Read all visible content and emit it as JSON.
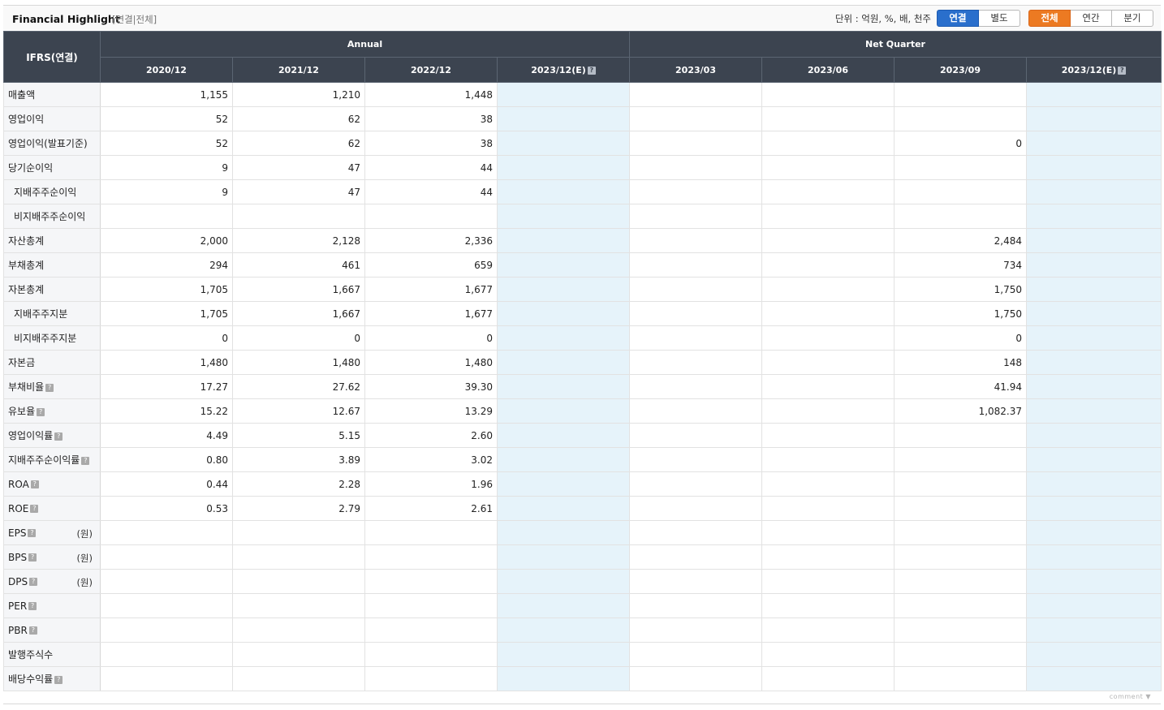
{
  "header": {
    "title": "Financial Highlight",
    "subtitle": "[연결|전체]",
    "unit_text": "단위 : 억원, %, 배, 천주",
    "consolidation_buttons": [
      "연결",
      "별도"
    ],
    "period_buttons": [
      "전체",
      "연간",
      "분기"
    ],
    "colors": {
      "consolidation_active": "#2a6fcc",
      "period_active": "#ec7a22",
      "header_bg": "#3c4450",
      "estimate_bg": "#e6f3fa"
    }
  },
  "table": {
    "corner_label": "IFRS(연결)",
    "group_annual": "Annual",
    "group_quarter": "Net Quarter",
    "columns": [
      "2020/12",
      "2021/12",
      "2022/12",
      "2023/12(E)",
      "2023/03",
      "2023/06",
      "2023/09",
      "2023/12(E)"
    ],
    "help_icon": "?",
    "rows": [
      {
        "label": "매출액",
        "suffix": "",
        "values": [
          "1,155",
          "1,210",
          "1,448",
          "",
          "",
          "",
          "",
          ""
        ]
      },
      {
        "label": "영업이익",
        "suffix": "",
        "values": [
          "52",
          "62",
          "38",
          "",
          "",
          "",
          "",
          ""
        ]
      },
      {
        "label": "영업이익(발표기준)",
        "suffix": "",
        "values": [
          "52",
          "62",
          "38",
          "",
          "",
          "",
          "0",
          ""
        ]
      },
      {
        "label": "당기순이익",
        "suffix": "",
        "values": [
          "9",
          "47",
          "44",
          "",
          "",
          "",
          "",
          ""
        ]
      },
      {
        "label": "지배주주순이익",
        "suffix": "",
        "values": [
          "9",
          "47",
          "44",
          "",
          "",
          "",
          "",
          ""
        ]
      },
      {
        "label": "비지배주주순이익",
        "suffix": "",
        "values": [
          "",
          "",
          "",
          "",
          "",
          "",
          "",
          ""
        ]
      },
      {
        "label": "자산총계",
        "suffix": "",
        "values": [
          "2,000",
          "2,128",
          "2,336",
          "",
          "",
          "",
          "2,484",
          ""
        ]
      },
      {
        "label": "부채총계",
        "suffix": "",
        "values": [
          "294",
          "461",
          "659",
          "",
          "",
          "",
          "734",
          ""
        ]
      },
      {
        "label": "자본총계",
        "suffix": "",
        "values": [
          "1,705",
          "1,667",
          "1,677",
          "",
          "",
          "",
          "1,750",
          ""
        ]
      },
      {
        "label": "지배주주지분",
        "suffix": "",
        "values": [
          "1,705",
          "1,667",
          "1,677",
          "",
          "",
          "",
          "1,750",
          ""
        ]
      },
      {
        "label": "비지배주주지분",
        "suffix": "",
        "values": [
          "0",
          "0",
          "0",
          "",
          "",
          "",
          "0",
          ""
        ]
      },
      {
        "label": "자본금",
        "suffix": "",
        "values": [
          "1,480",
          "1,480",
          "1,480",
          "",
          "",
          "",
          "148",
          ""
        ]
      },
      {
        "label": "부채비율",
        "suffix": "",
        "values": [
          "17.27",
          "27.62",
          "39.30",
          "",
          "",
          "",
          "41.94",
          ""
        ]
      },
      {
        "label": "유보율",
        "suffix": "",
        "values": [
          "15.22",
          "12.67",
          "13.29",
          "",
          "",
          "",
          "1,082.37",
          ""
        ]
      },
      {
        "label": "영업이익률",
        "suffix": "",
        "values": [
          "4.49",
          "5.15",
          "2.60",
          "",
          "",
          "",
          "",
          ""
        ]
      },
      {
        "label": "지배주주순이익률",
        "suffix": "",
        "values": [
          "0.80",
          "3.89",
          "3.02",
          "",
          "",
          "",
          "",
          ""
        ]
      },
      {
        "label": "ROA",
        "suffix": "",
        "values": [
          "0.44",
          "2.28",
          "1.96",
          "",
          "",
          "",
          "",
          ""
        ]
      },
      {
        "label": "ROE",
        "suffix": "",
        "values": [
          "0.53",
          "2.79",
          "2.61",
          "",
          "",
          "",
          "",
          ""
        ]
      },
      {
        "label": "EPS",
        "suffix": "(원)",
        "values": [
          "",
          "",
          "",
          "",
          "",
          "",
          "",
          ""
        ]
      },
      {
        "label": "BPS",
        "suffix": "(원)",
        "values": [
          "",
          "",
          "",
          "",
          "",
          "",
          "",
          ""
        ]
      },
      {
        "label": "DPS",
        "suffix": "(원)",
        "values": [
          "",
          "",
          "",
          "",
          "",
          "",
          "",
          ""
        ]
      },
      {
        "label": "PER",
        "suffix": "",
        "values": [
          "",
          "",
          "",
          "",
          "",
          "",
          "",
          ""
        ]
      },
      {
        "label": "PBR",
        "suffix": "",
        "values": [
          "",
          "",
          "",
          "",
          "",
          "",
          "",
          ""
        ]
      },
      {
        "label": "발행주식수",
        "suffix": "",
        "values": [
          "",
          "",
          "",
          "",
          "",
          "",
          "",
          ""
        ]
      },
      {
        "label": "배당수익률",
        "suffix": "",
        "values": [
          "",
          "",
          "",
          "",
          "",
          "",
          "",
          ""
        ]
      }
    ]
  },
  "footer": {
    "comment_label": "comment"
  }
}
